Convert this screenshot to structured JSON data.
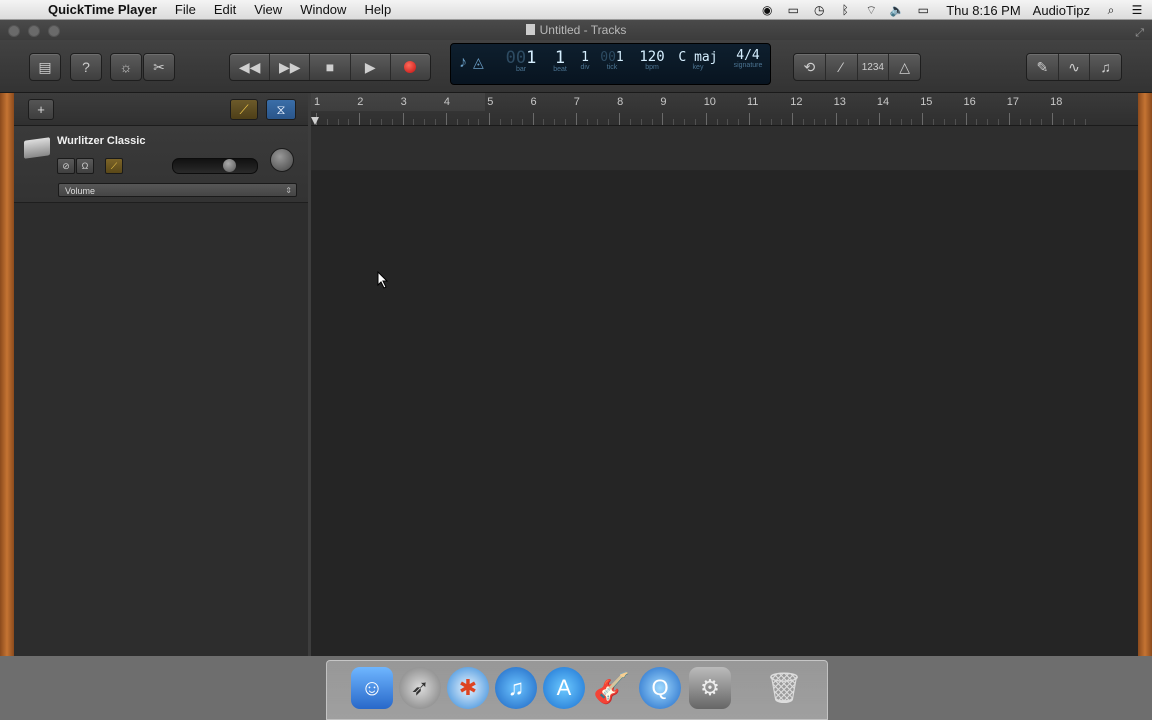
{
  "menubar": {
    "app_name": "QuickTime Player",
    "items": [
      "File",
      "Edit",
      "View",
      "Window",
      "Help"
    ],
    "clock": "Thu 8:16 PM",
    "user": "AudioTipz"
  },
  "window": {
    "title": "Untitled - Tracks"
  },
  "lcd": {
    "bar": "1",
    "beat": "1",
    "div": "1",
    "tick": "1",
    "tempo": "120",
    "key": "C maj",
    "signature": "4/4",
    "labels": {
      "bar": "bar",
      "beat": "beat",
      "div": "div",
      "tick": "tick",
      "bpm": "bpm",
      "key": "key",
      "signature": "signature"
    }
  },
  "toolbar": {
    "count_in_label": "1234"
  },
  "track": {
    "name": "Wurlitzer Classic",
    "automation_param": "Volume",
    "volume_level": 0.72
  },
  "ruler": {
    "bars": [
      "1",
      "2",
      "3",
      "4",
      "5",
      "6",
      "7",
      "8",
      "9",
      "10",
      "11",
      "12",
      "13",
      "14",
      "15",
      "16",
      "17",
      "18"
    ]
  },
  "colors": {
    "record": "#c20f0f",
    "accent_yellow": "#c89b2a",
    "accent_blue": "#3a7cc9",
    "wood": "#c57433"
  },
  "dock": {
    "apps": [
      "finder-icon",
      "launchpad-icon",
      "safari-icon",
      "itunes-icon",
      "app-store-icon",
      "garageband-icon",
      "quicktime-icon",
      "system-preferences-icon",
      "trash-icon"
    ]
  }
}
